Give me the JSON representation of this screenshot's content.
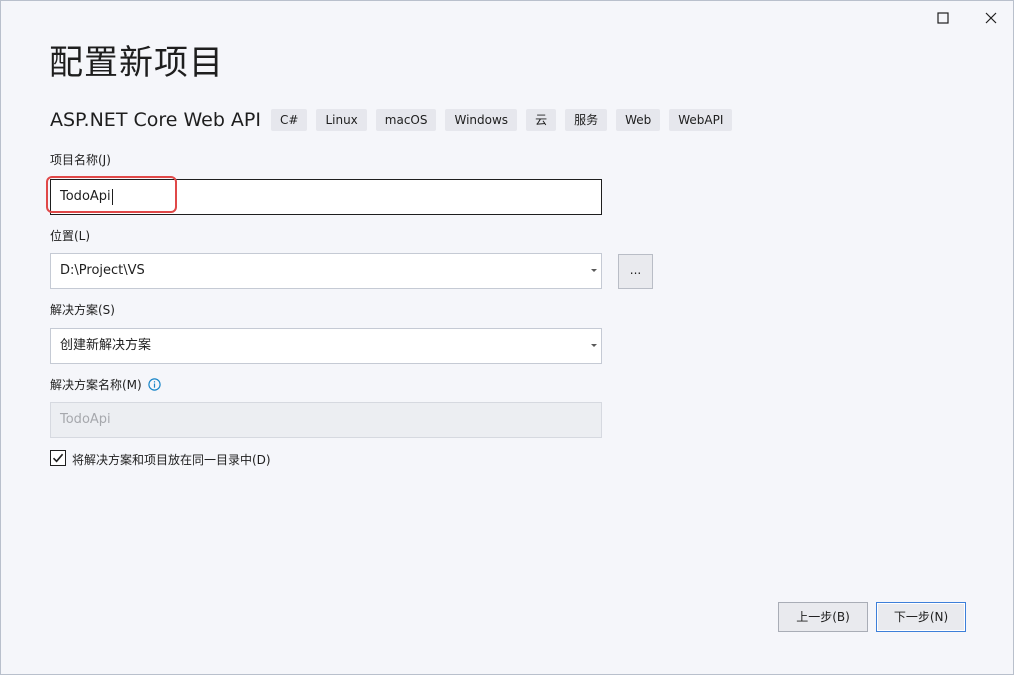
{
  "window": {
    "controls": {
      "maximize_icon": "maximize-icon",
      "close_icon": "close-icon"
    }
  },
  "page": {
    "title": "配置新项目",
    "template_name": "ASP.NET Core Web API",
    "tags": [
      "C#",
      "Linux",
      "macOS",
      "Windows",
      "云",
      "服务",
      "Web",
      "WebAPI"
    ]
  },
  "form": {
    "project_name": {
      "label": "项目名称(J)",
      "value": "TodoApi"
    },
    "location": {
      "label": "位置(L)",
      "value": "D:\\Project\\VS",
      "browse_label": "..."
    },
    "solution": {
      "label": "解决方案(S)",
      "value": "创建新解决方案"
    },
    "solution_name": {
      "label": "解决方案名称(M)",
      "value": "TodoApi",
      "info_icon": "info-icon"
    },
    "same_directory": {
      "label": "将解决方案和项目放在同一目录中(D)",
      "checked": true
    }
  },
  "footer": {
    "back_label": "上一步(B)",
    "next_label": "下一步(N)"
  },
  "colors": {
    "highlight": "#e04848",
    "info": "#1a86c8",
    "default_button_border": "#3d7fd9"
  }
}
